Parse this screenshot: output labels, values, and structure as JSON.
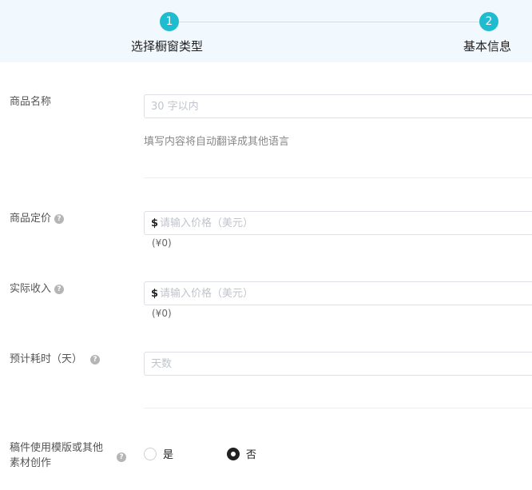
{
  "steps": [
    {
      "number": "1",
      "label": "选择橱窗类型"
    },
    {
      "number": "2",
      "label": "基本信息"
    }
  ],
  "colors": {
    "accent": "#1fbccf",
    "steps_bg": "#f1f8fe"
  },
  "form": {
    "product_name": {
      "label": "商品名称",
      "placeholder": "30 字以内",
      "hint": "填写内容将自动翻译成其他语言"
    },
    "price": {
      "label": "商品定价",
      "currency": "$",
      "placeholder": "请输入价格（美元）",
      "converted": "(¥0)"
    },
    "income": {
      "label": "实际收入",
      "currency": "$",
      "placeholder": "请输入价格（美元）",
      "converted": "(¥0)"
    },
    "duration": {
      "label": "预计耗时（天）",
      "placeholder": "天数"
    },
    "template": {
      "label_line1": "稿件使用模版或其他",
      "label_line2": "素材创作",
      "options": [
        {
          "label": "是",
          "checked": false
        },
        {
          "label": "否",
          "checked": true
        }
      ]
    }
  }
}
